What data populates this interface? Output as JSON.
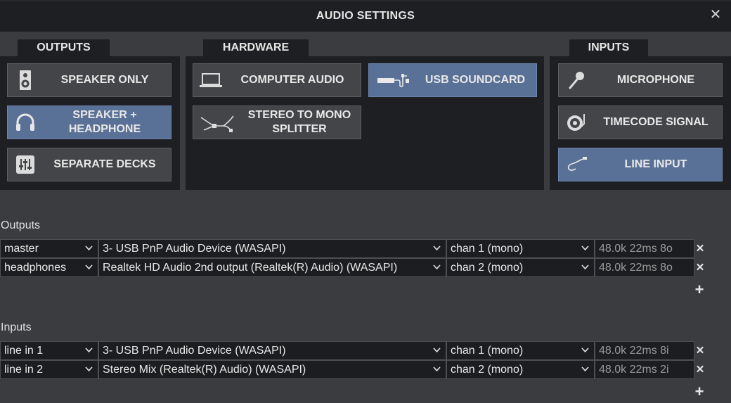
{
  "window": {
    "title": "AUDIO SETTINGS"
  },
  "tabs": {
    "outputs": "OUTPUTS",
    "hardware": "HARDWARE",
    "inputs": "INPUTS"
  },
  "outputs_buttons": [
    {
      "label": "SPEAKER ONLY",
      "icon": "speaker-icon",
      "active": false
    },
    {
      "label": "SPEAKER +\nHEADPHONE",
      "icon": "headphone-icon",
      "active": true
    },
    {
      "label": "SEPARATE DECKS",
      "icon": "mixer-sliders-icon",
      "active": false
    }
  ],
  "hardware_buttons": [
    {
      "label": "COMPUTER AUDIO",
      "icon": "laptop-icon",
      "active": false
    },
    {
      "label": "USB SOUNDCARD",
      "icon": "usb-soundcard-icon",
      "active": true
    },
    {
      "label": "STEREO TO MONO\nSPLITTER",
      "icon": "splitter-cable-icon",
      "active": false
    }
  ],
  "inputs_buttons": [
    {
      "label": "MICROPHONE",
      "icon": "microphone-icon",
      "active": false
    },
    {
      "label": "TIMECODE SIGNAL",
      "icon": "turntable-icon",
      "active": false
    },
    {
      "label": "LINE INPUT",
      "icon": "line-cable-icon",
      "active": true
    }
  ],
  "outputs_section": {
    "label": "Outputs",
    "rows": [
      {
        "channel": "master",
        "device": "3- USB PnP Audio Device (WASAPI)",
        "chan": "chan 1 (mono)",
        "info": "48.0k 22ms 8o"
      },
      {
        "channel": "headphones",
        "device": "Realtek HD Audio 2nd output (Realtek(R) Audio) (WASAPI)",
        "chan": "chan 2 (mono)",
        "info": "48.0k 22ms 8o"
      }
    ]
  },
  "inputs_section": {
    "label": "Inputs",
    "rows": [
      {
        "channel": "line in 1",
        "device": "3- USB PnP Audio Device (WASAPI)",
        "chan": "chan 1 (mono)",
        "info": "48.0k 22ms 8i"
      },
      {
        "channel": "line in 2",
        "device": "Stereo Mix (Realtek(R) Audio) (WASAPI)",
        "chan": "chan 2 (mono)",
        "info": "48.0k 22ms 2i"
      }
    ]
  },
  "symbols": {
    "close": "✕",
    "remove": "✕",
    "add": "+"
  },
  "colors": {
    "active_button": "#5a7197",
    "panel": "#1e1f22",
    "background": "#3b3c40"
  }
}
